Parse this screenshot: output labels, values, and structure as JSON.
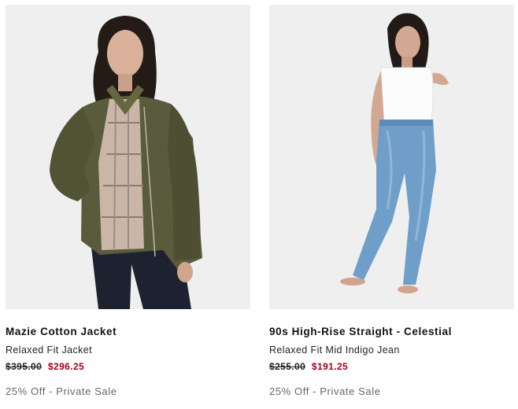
{
  "products": [
    {
      "name": "Mazie Cotton Jacket",
      "subtitle": "Relaxed Fit Jacket",
      "original_price": "$395.00",
      "sale_price": "$296.25",
      "promo": "25% Off - Private Sale"
    },
    {
      "name": "90s High-Rise Straight - Celestial",
      "subtitle": "Relaxed Fit Mid Indigo Jean",
      "original_price": "$255.00",
      "sale_price": "$191.25",
      "promo": "25% Off - Private Sale"
    }
  ],
  "colors": {
    "photo_bg": "#efefef",
    "sale_price": "#a3001b",
    "promo_text": "#666666"
  }
}
